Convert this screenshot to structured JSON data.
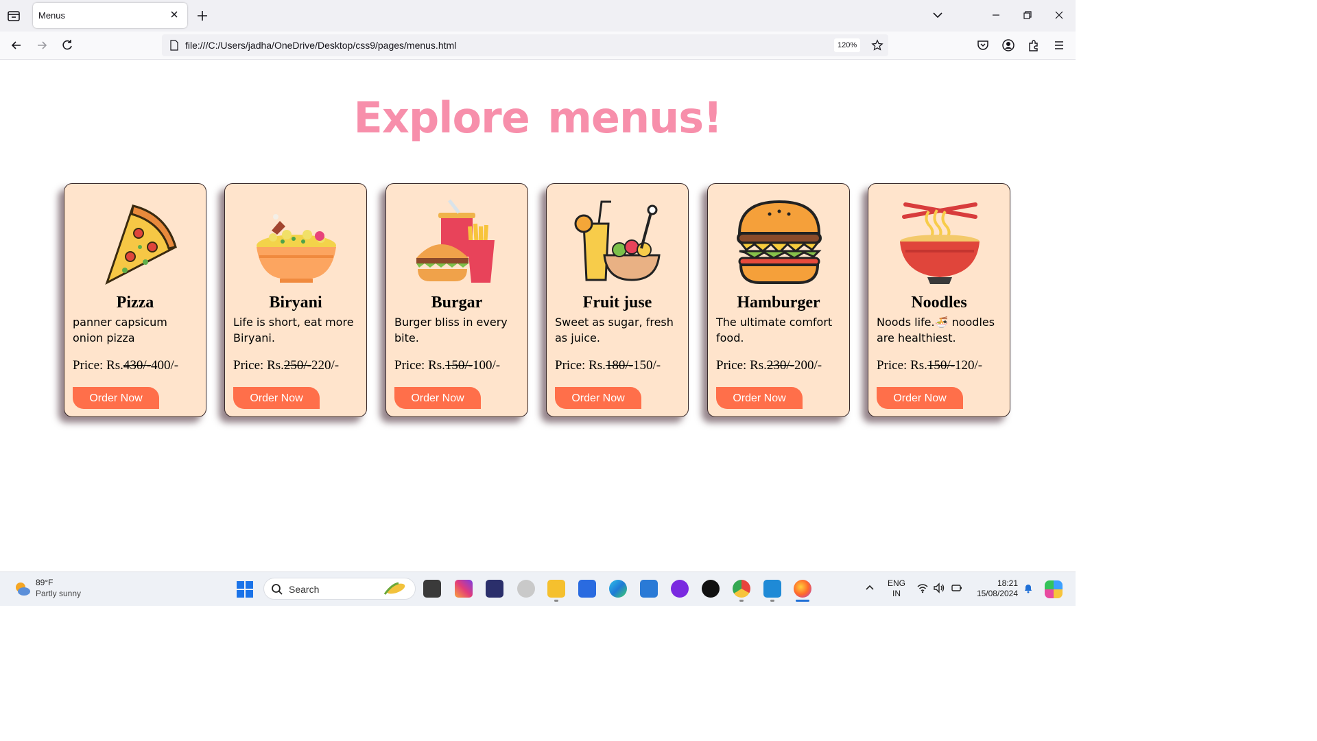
{
  "browser": {
    "tab_title": "Menus",
    "url": "file:///C:/Users/jadha/OneDrive/Desktop/css9/pages/menus.html",
    "zoom": "120%"
  },
  "page": {
    "heading": "Explore menus!",
    "heading_color": "#f78fab",
    "card_background": "#ffe4cc",
    "button_color": "#ff6f4a",
    "price_prefix": "Price: Rs.",
    "price_suffix": "/-",
    "cards": [
      {
        "title": "Pizza",
        "description": "panner capsicum onion pizza",
        "old_price": "430/-",
        "new_price": "400",
        "button": "Order Now",
        "icon": "pizza-icon"
      },
      {
        "title": "Biryani",
        "description": "Life is short, eat more Biryani.",
        "old_price": "250/-",
        "new_price": "220",
        "button": "Order Now",
        "icon": "biryani-icon"
      },
      {
        "title": "Burgar",
        "description": "Burger bliss in every bite.",
        "old_price": "150/-",
        "new_price": "100",
        "button": "Order Now",
        "icon": "burger-combo-icon"
      },
      {
        "title": "Fruit juse",
        "description": "Sweet as sugar, fresh as juice.",
        "old_price": "180/-",
        "new_price": "150",
        "button": "Order Now",
        "icon": "juice-salad-icon"
      },
      {
        "title": "Hamburger",
        "description": "The ultimate comfort food.",
        "old_price": "230/-",
        "new_price": "200",
        "button": "Order Now",
        "icon": "hamburger-icon"
      },
      {
        "title": "Noodles",
        "description": "Noods life.🍜 noodles are healthiest.",
        "old_price": "150/-",
        "new_price": "120",
        "button": "Order Now",
        "icon": "noodles-icon"
      }
    ]
  },
  "taskbar": {
    "weather_temp": "89°F",
    "weather_desc": "Partly sunny",
    "search_placeholder": "Search",
    "lang_line1": "ENG",
    "lang_line2": "IN",
    "time": "18:21",
    "date": "15/08/2024"
  }
}
